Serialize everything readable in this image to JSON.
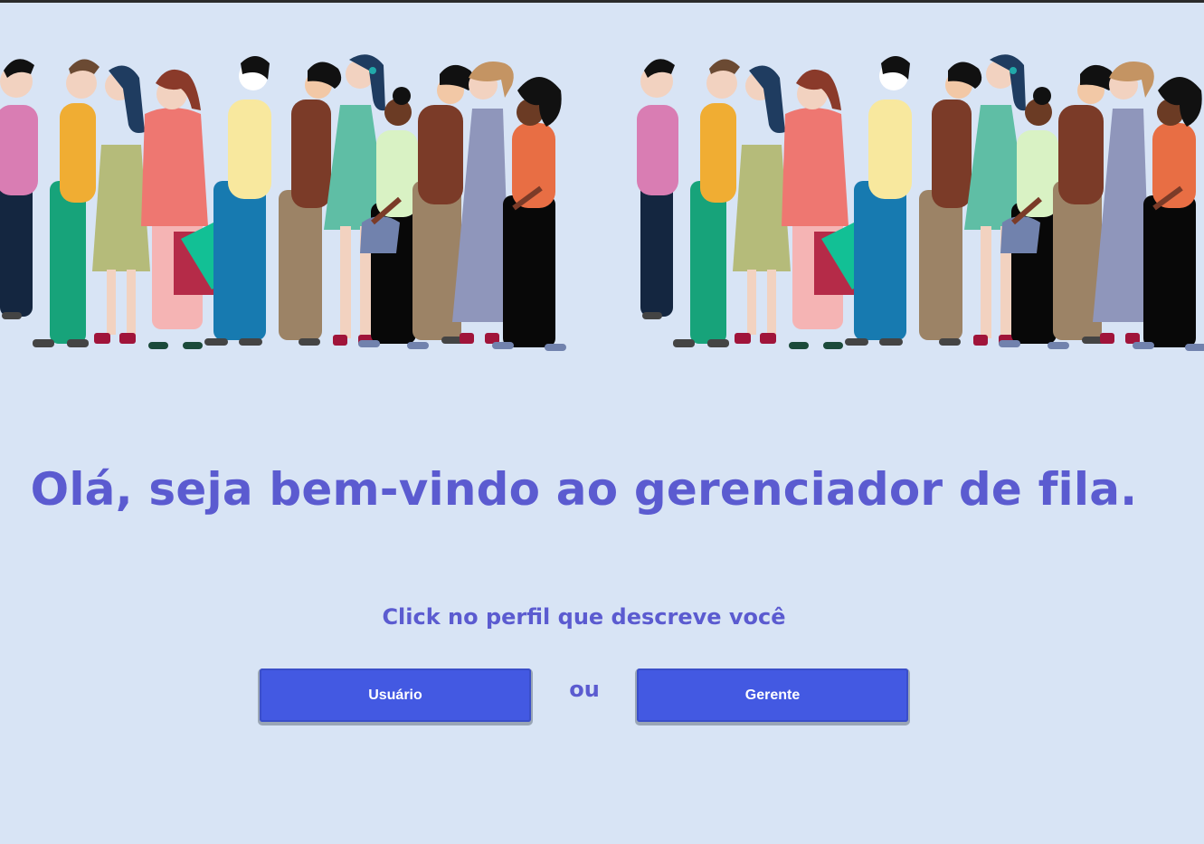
{
  "hero": {
    "illustration": "people-waiting-in-line-illustration",
    "colors": {
      "background": "#d8e4f5",
      "skin_light": "#f2d2c0",
      "skin_dark": "#6b3b24",
      "hair": "#111111"
    }
  },
  "welcome": {
    "title": "Olá, seja bem-vindo ao gerenciador de fila.",
    "subtitle": "Click no perfil que descreve você"
  },
  "actions": {
    "user_label": "Usuário",
    "or_label": "ou",
    "manager_label": "Gerente"
  },
  "theme": {
    "accent": "#5b5bd0",
    "button": "#4359e2",
    "button_text": "#ffffff"
  }
}
